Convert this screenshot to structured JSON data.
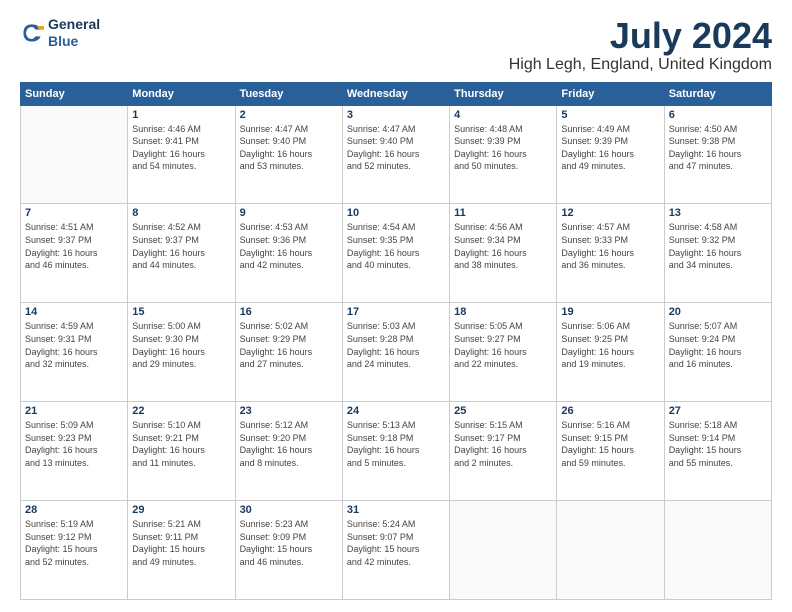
{
  "logo": {
    "line1": "General",
    "line2": "Blue"
  },
  "title": "July 2024",
  "location": "High Legh, England, United Kingdom",
  "weekdays": [
    "Sunday",
    "Monday",
    "Tuesday",
    "Wednesday",
    "Thursday",
    "Friday",
    "Saturday"
  ],
  "weeks": [
    [
      {
        "day": "",
        "info": ""
      },
      {
        "day": "1",
        "info": "Sunrise: 4:46 AM\nSunset: 9:41 PM\nDaylight: 16 hours\nand 54 minutes."
      },
      {
        "day": "2",
        "info": "Sunrise: 4:47 AM\nSunset: 9:40 PM\nDaylight: 16 hours\nand 53 minutes."
      },
      {
        "day": "3",
        "info": "Sunrise: 4:47 AM\nSunset: 9:40 PM\nDaylight: 16 hours\nand 52 minutes."
      },
      {
        "day": "4",
        "info": "Sunrise: 4:48 AM\nSunset: 9:39 PM\nDaylight: 16 hours\nand 50 minutes."
      },
      {
        "day": "5",
        "info": "Sunrise: 4:49 AM\nSunset: 9:39 PM\nDaylight: 16 hours\nand 49 minutes."
      },
      {
        "day": "6",
        "info": "Sunrise: 4:50 AM\nSunset: 9:38 PM\nDaylight: 16 hours\nand 47 minutes."
      }
    ],
    [
      {
        "day": "7",
        "info": "Sunrise: 4:51 AM\nSunset: 9:37 PM\nDaylight: 16 hours\nand 46 minutes."
      },
      {
        "day": "8",
        "info": "Sunrise: 4:52 AM\nSunset: 9:37 PM\nDaylight: 16 hours\nand 44 minutes."
      },
      {
        "day": "9",
        "info": "Sunrise: 4:53 AM\nSunset: 9:36 PM\nDaylight: 16 hours\nand 42 minutes."
      },
      {
        "day": "10",
        "info": "Sunrise: 4:54 AM\nSunset: 9:35 PM\nDaylight: 16 hours\nand 40 minutes."
      },
      {
        "day": "11",
        "info": "Sunrise: 4:56 AM\nSunset: 9:34 PM\nDaylight: 16 hours\nand 38 minutes."
      },
      {
        "day": "12",
        "info": "Sunrise: 4:57 AM\nSunset: 9:33 PM\nDaylight: 16 hours\nand 36 minutes."
      },
      {
        "day": "13",
        "info": "Sunrise: 4:58 AM\nSunset: 9:32 PM\nDaylight: 16 hours\nand 34 minutes."
      }
    ],
    [
      {
        "day": "14",
        "info": "Sunrise: 4:59 AM\nSunset: 9:31 PM\nDaylight: 16 hours\nand 32 minutes."
      },
      {
        "day": "15",
        "info": "Sunrise: 5:00 AM\nSunset: 9:30 PM\nDaylight: 16 hours\nand 29 minutes."
      },
      {
        "day": "16",
        "info": "Sunrise: 5:02 AM\nSunset: 9:29 PM\nDaylight: 16 hours\nand 27 minutes."
      },
      {
        "day": "17",
        "info": "Sunrise: 5:03 AM\nSunset: 9:28 PM\nDaylight: 16 hours\nand 24 minutes."
      },
      {
        "day": "18",
        "info": "Sunrise: 5:05 AM\nSunset: 9:27 PM\nDaylight: 16 hours\nand 22 minutes."
      },
      {
        "day": "19",
        "info": "Sunrise: 5:06 AM\nSunset: 9:25 PM\nDaylight: 16 hours\nand 19 minutes."
      },
      {
        "day": "20",
        "info": "Sunrise: 5:07 AM\nSunset: 9:24 PM\nDaylight: 16 hours\nand 16 minutes."
      }
    ],
    [
      {
        "day": "21",
        "info": "Sunrise: 5:09 AM\nSunset: 9:23 PM\nDaylight: 16 hours\nand 13 minutes."
      },
      {
        "day": "22",
        "info": "Sunrise: 5:10 AM\nSunset: 9:21 PM\nDaylight: 16 hours\nand 11 minutes."
      },
      {
        "day": "23",
        "info": "Sunrise: 5:12 AM\nSunset: 9:20 PM\nDaylight: 16 hours\nand 8 minutes."
      },
      {
        "day": "24",
        "info": "Sunrise: 5:13 AM\nSunset: 9:18 PM\nDaylight: 16 hours\nand 5 minutes."
      },
      {
        "day": "25",
        "info": "Sunrise: 5:15 AM\nSunset: 9:17 PM\nDaylight: 16 hours\nand 2 minutes."
      },
      {
        "day": "26",
        "info": "Sunrise: 5:16 AM\nSunset: 9:15 PM\nDaylight: 15 hours\nand 59 minutes."
      },
      {
        "day": "27",
        "info": "Sunrise: 5:18 AM\nSunset: 9:14 PM\nDaylight: 15 hours\nand 55 minutes."
      }
    ],
    [
      {
        "day": "28",
        "info": "Sunrise: 5:19 AM\nSunset: 9:12 PM\nDaylight: 15 hours\nand 52 minutes."
      },
      {
        "day": "29",
        "info": "Sunrise: 5:21 AM\nSunset: 9:11 PM\nDaylight: 15 hours\nand 49 minutes."
      },
      {
        "day": "30",
        "info": "Sunrise: 5:23 AM\nSunset: 9:09 PM\nDaylight: 15 hours\nand 46 minutes."
      },
      {
        "day": "31",
        "info": "Sunrise: 5:24 AM\nSunset: 9:07 PM\nDaylight: 15 hours\nand 42 minutes."
      },
      {
        "day": "",
        "info": ""
      },
      {
        "day": "",
        "info": ""
      },
      {
        "day": "",
        "info": ""
      }
    ]
  ]
}
